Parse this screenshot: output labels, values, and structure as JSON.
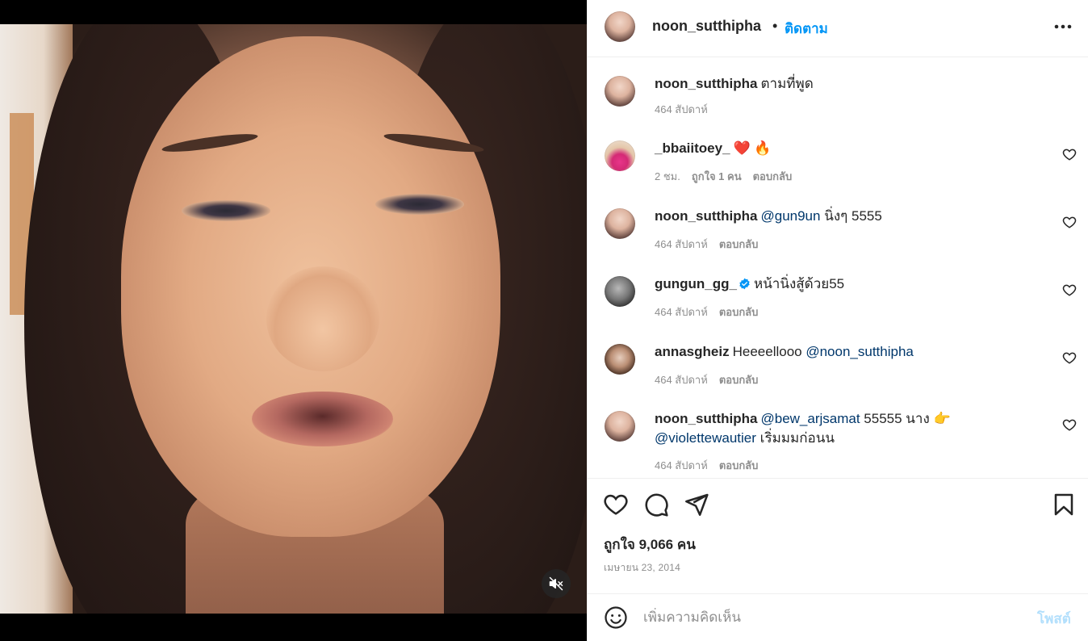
{
  "post": {
    "author": "noon_sutthipha",
    "separator": "•",
    "follow_label": "ติดตาม",
    "more_icon": "more-horizontal-icon"
  },
  "comments": [
    {
      "user": "noon_sutthipha",
      "text": "ตามที่พูด",
      "time": "464 สัปดาห์",
      "avatar_icon": "avatar"
    },
    {
      "user": "_bbaiitoey_",
      "text": "❤️ 🔥",
      "time": "2 ชม.",
      "likes": "ถูกใจ 1 คน",
      "reply": "ตอบกลับ"
    },
    {
      "user": "noon_sutthipha",
      "mention": "@gun9un",
      "text": " นิ่งๆ 5555",
      "time": "464 สัปดาห์",
      "reply": "ตอบกลับ"
    },
    {
      "user": "gungun_gg_",
      "verified": true,
      "text": "หน้านิ่งสู้ด้วย55",
      "time": "464 สัปดาห์",
      "reply": "ตอบกลับ"
    },
    {
      "user": "annasgheiz",
      "text": "Heeeellooo ",
      "mention": "@noon_sutthipha",
      "time": "464 สัปดาห์",
      "reply": "ตอบกลับ"
    },
    {
      "user": "noon_sutthipha",
      "mention": "@bew_arjsamat",
      "text": " 55555 นาง 👉",
      "mention2": "@violettewautier",
      "text2": " เริ่มมมก่อนน",
      "time": "464 สัปดาห์",
      "reply": "ตอบกลับ"
    }
  ],
  "engagement": {
    "likes_text": "ถูกใจ 9,066 คน",
    "date": "เมษายน 23, 2014"
  },
  "composer": {
    "placeholder": "เพิ่มความคิดเห็น",
    "post_label": "โพสต์"
  },
  "colors": {
    "accent": "#0095f6",
    "post_disabled": "#b2dffc",
    "mention": "#00376b",
    "muted": "#8e8e8e",
    "text": "#262626"
  }
}
